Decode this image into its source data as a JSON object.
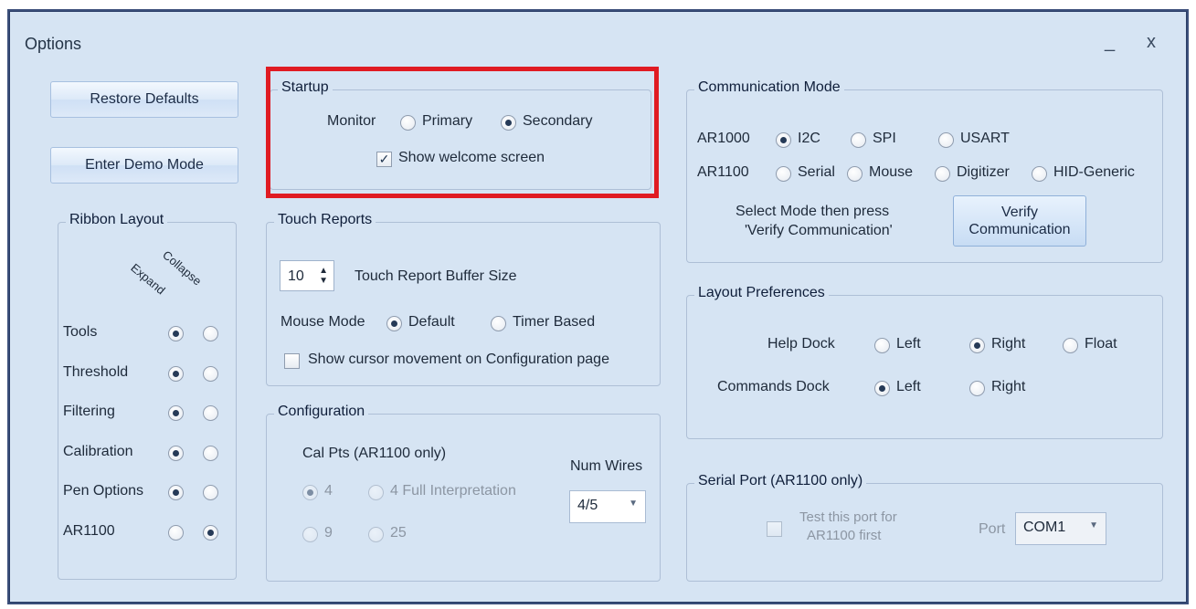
{
  "window": {
    "title": "Options",
    "minimize": "_",
    "close": "x"
  },
  "left": {
    "restore_defaults": "Restore Defaults",
    "enter_demo_mode": "Enter Demo Mode",
    "ribbon_layout": {
      "title": "Ribbon Layout",
      "col_expand": "Expand",
      "col_collapse": "Collapse",
      "rows": [
        {
          "label": "Tools",
          "selected": "expand"
        },
        {
          "label": "Threshold",
          "selected": "expand"
        },
        {
          "label": "Filtering",
          "selected": "expand"
        },
        {
          "label": "Calibration",
          "selected": "expand"
        },
        {
          "label": "Pen Options",
          "selected": "expand"
        },
        {
          "label": "AR1100",
          "selected": "collapse"
        }
      ]
    }
  },
  "startup": {
    "title": "Startup",
    "monitor_label": "Monitor",
    "primary": "Primary",
    "secondary": "Secondary",
    "selected": "secondary",
    "show_welcome": "Show welcome screen",
    "show_welcome_checked": true
  },
  "touch_reports": {
    "title": "Touch Reports",
    "buffer_value": "10",
    "buffer_label": "Touch Report Buffer Size",
    "mouse_mode_label": "Mouse Mode",
    "default": "Default",
    "timer_based": "Timer Based",
    "selected": "default",
    "show_cursor": "Show cursor movement on Configuration page",
    "show_cursor_checked": false
  },
  "configuration": {
    "title": "Configuration",
    "cal_pts_label": "Cal Pts (AR1100 only)",
    "opt_4": "4",
    "opt_4_full": "4 Full Interpretation",
    "opt_9": "9",
    "opt_25": "25",
    "num_wires_label": "Num Wires",
    "num_wires_value": "4/5"
  },
  "communication": {
    "title": "Communication Mode",
    "ar1000_label": "AR1000",
    "ar1000_options": [
      "I2C",
      "SPI",
      "USART"
    ],
    "ar1000_selected": "I2C",
    "ar1100_label": "AR1100",
    "ar1100_options": [
      "Serial",
      "Mouse",
      "Digitizer",
      "HID-Generic"
    ],
    "select_mode_line1": "Select Mode then press",
    "select_mode_line2": "'Verify Communication'",
    "verify_line1": "Verify",
    "verify_line2": "Communication"
  },
  "layout_prefs": {
    "title": "Layout Preferences",
    "help_dock_label": "Help Dock",
    "help_left": "Left",
    "help_right": "Right",
    "help_float": "Float",
    "help_selected": "Right",
    "commands_dock_label": "Commands Dock",
    "cmd_left": "Left",
    "cmd_right": "Right",
    "cmd_selected": "Left"
  },
  "serial_port": {
    "title": "Serial Port (AR1100 only)",
    "test_line1": "Test this port for",
    "test_line2": "AR1100 first",
    "port_label": "Port",
    "port_value": "COM1"
  },
  "colors": {
    "highlight_border": "#e01b22",
    "window_bg": "#d6e4f3"
  }
}
